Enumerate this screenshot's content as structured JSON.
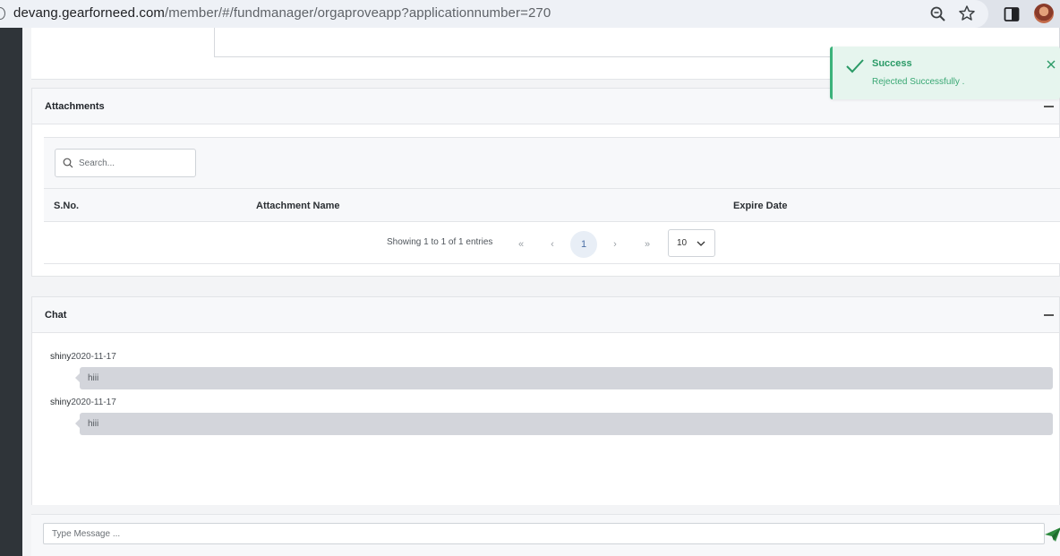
{
  "browser": {
    "url_host": "devang.gearforneed.com",
    "url_path": "/member/#/fundmanager/orgaproveapp?applicationnumber=270"
  },
  "attachments": {
    "title": "Attachments",
    "search_placeholder": "Search...",
    "columns": [
      "S.No.",
      "Attachment Name",
      "Expire Date"
    ],
    "showing_text": "Showing 1 to 1 of 1 entries",
    "pager": {
      "first": "«",
      "prev": "‹",
      "current": "1",
      "next": "›",
      "last": "»"
    },
    "page_size": "10"
  },
  "chat": {
    "title": "Chat",
    "messages": [
      {
        "user": "shiny",
        "date": "2020-11-17",
        "text": "hiii"
      },
      {
        "user": "shiny",
        "date": "2020-11-17",
        "text": "hiii"
      }
    ],
    "input_placeholder": "Type Message ..."
  },
  "toast": {
    "title": "Success",
    "message": "Rejected Successfully ."
  },
  "colors": {
    "success_green": "#2a9a66",
    "toast_bg": "#e6f5ee",
    "bubble_bg": "#d3d5db",
    "send_green": "#2e8b3f"
  }
}
